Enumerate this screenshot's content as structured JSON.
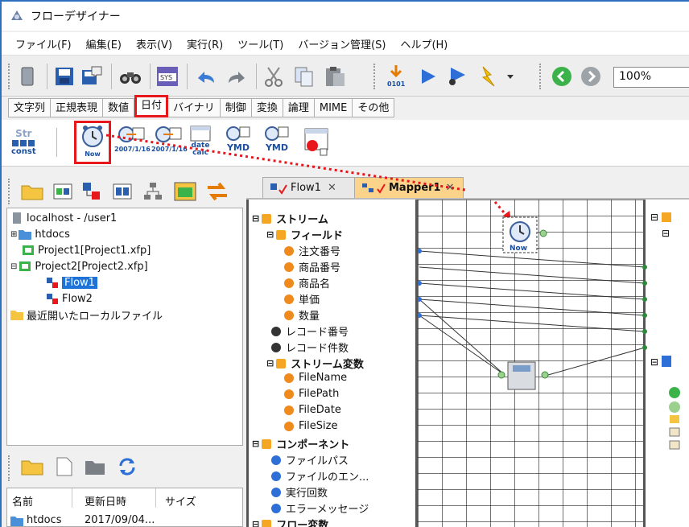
{
  "app": {
    "title": "フローデザイナー"
  },
  "menu": [
    "ファイル(F)",
    "編集(E)",
    "表示(V)",
    "実行(R)",
    "ツール(T)",
    "バージョン管理(S)",
    "ヘルプ(H)"
  ],
  "toolbar": {
    "zoom": "100%",
    "icons": [
      "trash-icon",
      "save-icon",
      "save-as-icon",
      "find-icon",
      "sys-icon",
      "undo-icon",
      "redo-icon",
      "cut-icon",
      "copy-icon",
      "paste-icon",
      "debug-icon",
      "run-icon",
      "debug-run-icon",
      "lightning-icon",
      "dropdown-icon",
      "back-icon",
      "forward-icon"
    ]
  },
  "category_tabs": [
    "文字列",
    "正規表現",
    "数値",
    "日付",
    "バイナリ",
    "制御",
    "変換",
    "論理",
    "MIME",
    "その他"
  ],
  "active_category": "日付",
  "palette": {
    "const_label": "Str",
    "const_sub": "const",
    "now_label": "Now",
    "date1_label": "2007/1/16",
    "date2_label": "2007/1/16",
    "calc_label": "date calc",
    "ymd1_label": "YMD",
    "ymd2_label": "YMD"
  },
  "project_tree": [
    {
      "label": "localhost - /user1"
    },
    {
      "label": "htdocs"
    },
    {
      "label": "Project1[Project1.xfp]"
    },
    {
      "label": "Project2[Project2.xfp]"
    },
    {
      "label": "Flow1"
    },
    {
      "label": "Flow2"
    },
    {
      "label": "最近開いたローカルファイル"
    }
  ],
  "file_list": {
    "columns": [
      "名前",
      "更新日時",
      "サイズ"
    ],
    "rows": [
      [
        "htdocs",
        "2017/09/04..."
      ]
    ]
  },
  "editor_tabs": [
    {
      "label": "Flow1"
    },
    {
      "label": "Mapper1"
    }
  ],
  "mapper_tree": [
    {
      "label": "ストリーム",
      "kind": "group"
    },
    {
      "label": "フィールド",
      "kind": "group"
    },
    {
      "label": "注文番号",
      "kind": "field"
    },
    {
      "label": "商品番号",
      "kind": "field"
    },
    {
      "label": "商品名",
      "kind": "field"
    },
    {
      "label": "単価",
      "kind": "field"
    },
    {
      "label": "数量",
      "kind": "field"
    },
    {
      "label": "レコード番号",
      "kind": "black"
    },
    {
      "label": "レコード件数",
      "kind": "black"
    },
    {
      "label": "ストリーム変数",
      "kind": "group"
    },
    {
      "label": "FileName",
      "kind": "field"
    },
    {
      "label": "FilePath",
      "kind": "field"
    },
    {
      "label": "FileDate",
      "kind": "field"
    },
    {
      "label": "FileSize",
      "kind": "field"
    },
    {
      "label": "コンポーネント",
      "kind": "group"
    },
    {
      "label": "ファイルパス",
      "kind": "blue"
    },
    {
      "label": "ファイルのエン...",
      "kind": "blue"
    },
    {
      "label": "実行回数",
      "kind": "blue"
    },
    {
      "label": "エラーメッセージ",
      "kind": "blue"
    },
    {
      "label": "フロー変数",
      "kind": "group"
    }
  ],
  "canvas": {
    "now_node_label": "Now"
  },
  "colors": {
    "highlight": "#e8171c",
    "selection": "#1e73d9",
    "tab_active": "#fbd38a"
  }
}
